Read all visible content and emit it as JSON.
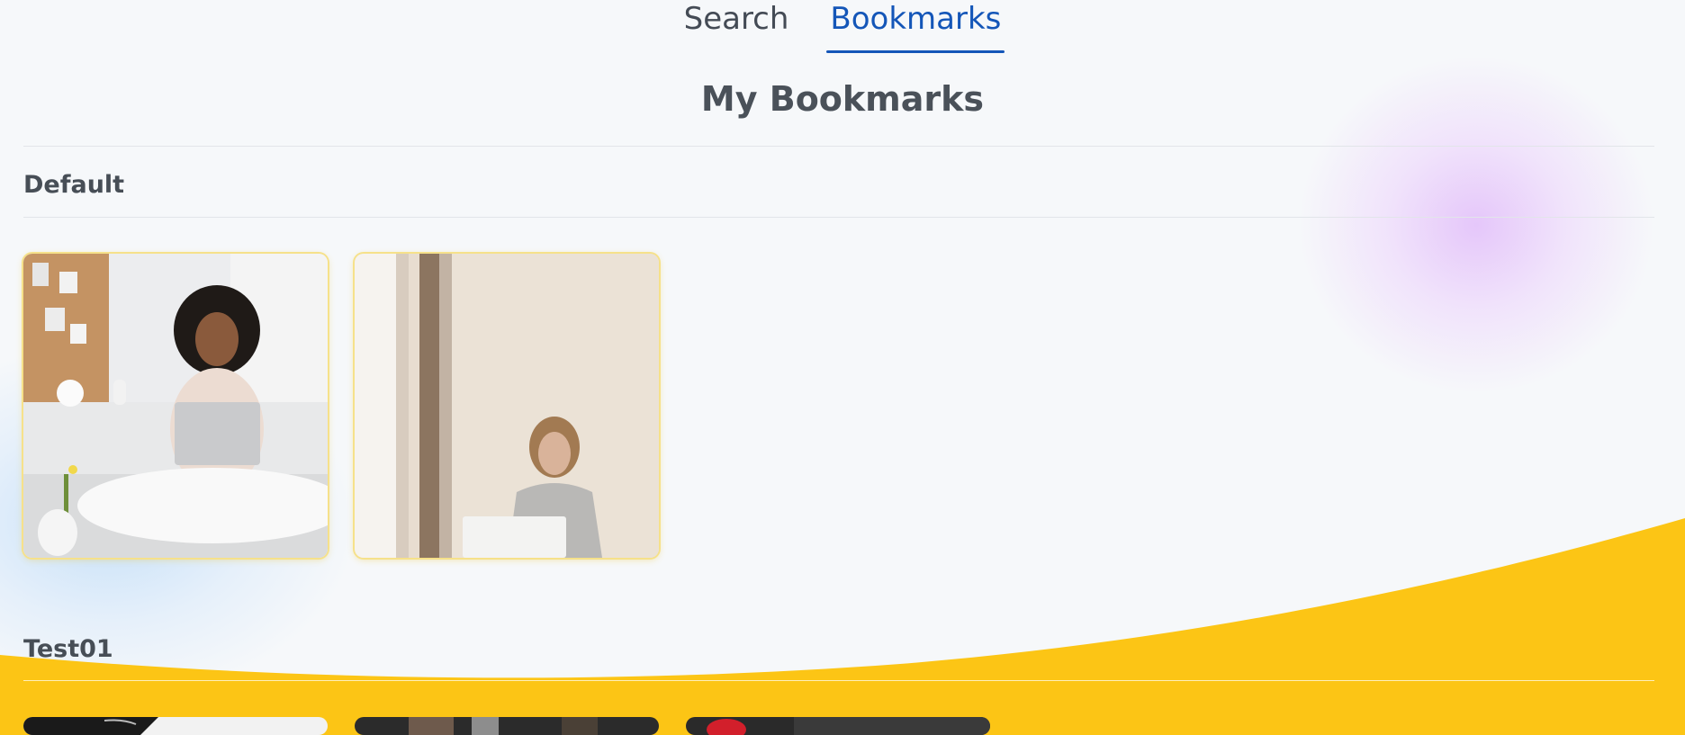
{
  "tabs": [
    {
      "label": "Search",
      "active": false
    },
    {
      "label": "Bookmarks",
      "active": true
    }
  ],
  "page_title": "My Bookmarks",
  "sections": [
    {
      "label": "Default",
      "items": [
        "woman-laptop-sitting-photo",
        "woman-laptop-window-photo"
      ]
    },
    {
      "label": "Test01",
      "items": [
        "photo-dark-1",
        "photo-dark-2",
        "photo-dark-3"
      ]
    }
  ],
  "colors": {
    "accent": "#1456b8",
    "wave": "#fcc515",
    "card_glow": "#f6e18a"
  }
}
